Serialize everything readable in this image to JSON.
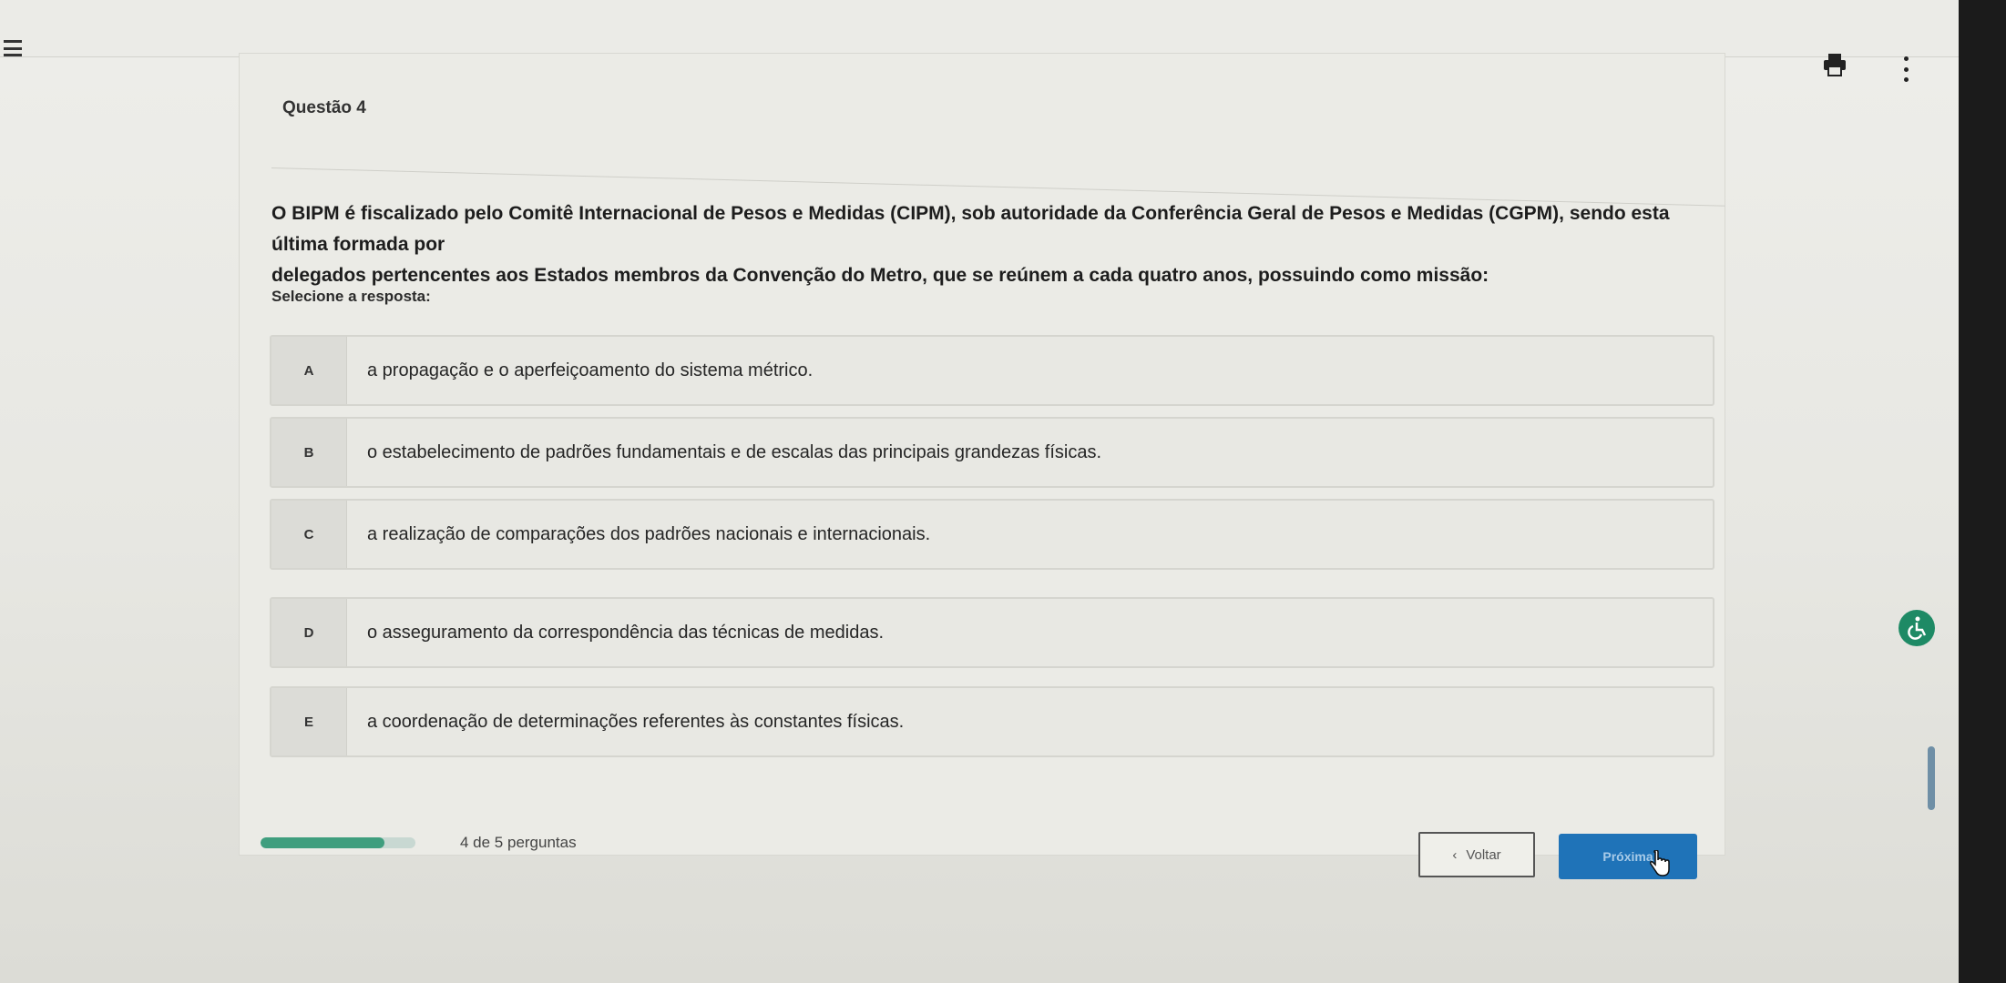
{
  "question": {
    "title": "Questão 4",
    "statement_line1": "O BIPM é fiscalizado pelo Comitê Internacional de Pesos e Medidas (CIPM), sob autoridade da Conferência Geral de Pesos e Medidas (CGPM), sendo esta última formada por",
    "statement_line2": "delegados pertencentes aos Estados membros da Convenção do Metro, que se reúnem a cada quatro anos, possuindo como missão:",
    "prompt": "Selecione a resposta:"
  },
  "options": [
    {
      "letter": "A",
      "text": "a propagação e o aperfeiçoamento do sistema métrico."
    },
    {
      "letter": "B",
      "text": "o estabelecimento de padrões fundamentais e de escalas das principais grandezas físicas."
    },
    {
      "letter": "C",
      "text": "a realização de comparações dos padrões nacionais e internacionais."
    },
    {
      "letter": "D",
      "text": "o asseguramento da correspondência das técnicas de medidas."
    },
    {
      "letter": "E",
      "text": "a coordenação de determinações referentes às constantes físicas."
    }
  ],
  "progress": {
    "label": "4 de 5 perguntas",
    "fraction": 0.8
  },
  "nav": {
    "back_label": "Voltar",
    "next_label": "Próxima"
  },
  "colors": {
    "accent_blue": "#1f73b8",
    "progress_green": "#3f9e7e"
  },
  "icons": [
    "menu-icon",
    "print-icon",
    "more-vertical-icon",
    "chevron-left-icon",
    "hand-cursor-icon",
    "accessibility-icon"
  ]
}
